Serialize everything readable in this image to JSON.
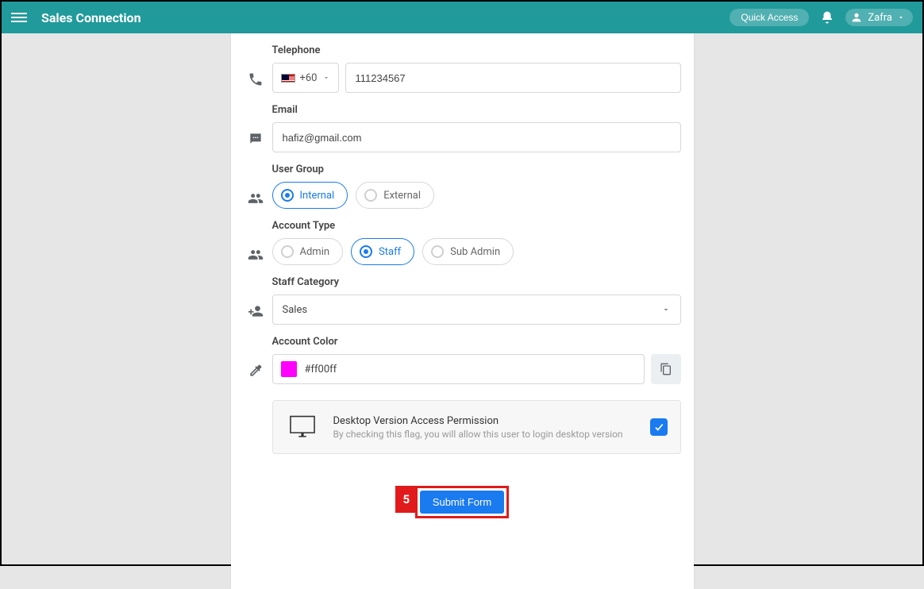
{
  "header": {
    "brand": "Sales Connection",
    "quick_access": "Quick Access",
    "user_name": "Zafra"
  },
  "form": {
    "telephone": {
      "label": "Telephone",
      "country_code": "+60",
      "value": "111234567"
    },
    "email": {
      "label": "Email",
      "value": "hafiz@gmail.com"
    },
    "user_group": {
      "label": "User Group",
      "options": {
        "internal": "Internal",
        "external": "External"
      }
    },
    "account_type": {
      "label": "Account Type",
      "options": {
        "admin": "Admin",
        "staff": "Staff",
        "subadmin": "Sub Admin"
      }
    },
    "staff_category": {
      "label": "Staff Category",
      "value": "Sales"
    },
    "account_color": {
      "label": "Account Color",
      "value": "#ff00ff"
    },
    "permission": {
      "title": "Desktop Version Access Permission",
      "subtitle": "By checking this flag, you will allow this user to login desktop version"
    },
    "submit": "Submit Form"
  },
  "annotation": {
    "step": "5"
  }
}
